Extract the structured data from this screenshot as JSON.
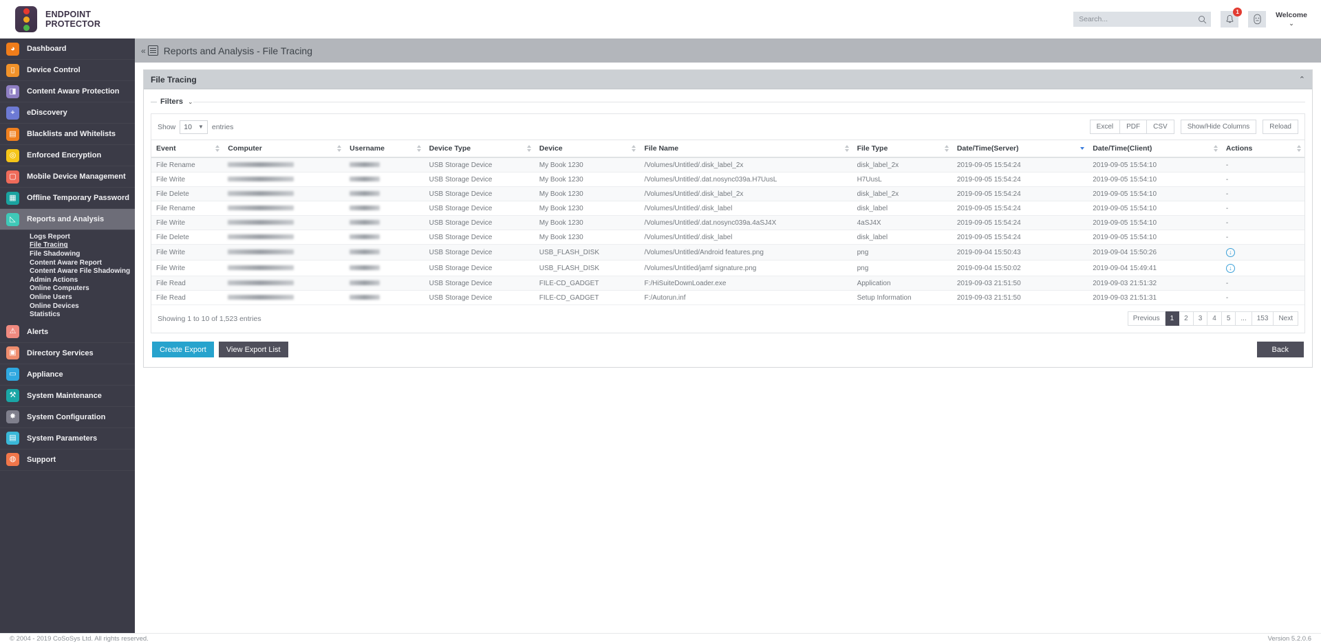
{
  "app": {
    "brand_line1": "ENDPOINT",
    "brand_line2": "PROTECTOR",
    "logo_icon": "traffic-light-icon"
  },
  "header": {
    "search_placeholder": "Search...",
    "search_value": "",
    "search_icon": "search-icon",
    "notifications_icon": "bell-icon",
    "notifications_count": "1",
    "profile_icon": "user-avatar-icon",
    "welcome_label": "Welcome",
    "welcome_caret": "⌄"
  },
  "sidebar": {
    "items": [
      {
        "label": "Dashboard",
        "icon": "dashboard-icon",
        "glyph": "◕",
        "color": "#f07d1a",
        "active": false
      },
      {
        "label": "Device Control",
        "icon": "usb-device-icon",
        "glyph": "▯",
        "color": "#f0922a",
        "active": false
      },
      {
        "label": "Content Aware Protection",
        "icon": "document-shield-icon",
        "glyph": "◨",
        "color": "#8f7fc4",
        "active": false
      },
      {
        "label": "eDiscovery",
        "icon": "telescope-icon",
        "glyph": "⌖",
        "color": "#6d7ad4",
        "active": false
      },
      {
        "label": "Blacklists and Whitelists",
        "icon": "list-icon",
        "glyph": "▤",
        "color": "#f0801f",
        "active": false
      },
      {
        "label": "Enforced Encryption",
        "icon": "disc-lock-icon",
        "glyph": "◎",
        "color": "#f5c518",
        "active": false
      },
      {
        "label": "Mobile Device Management",
        "icon": "mobile-icon",
        "glyph": "▢",
        "color": "#ef6b5a",
        "active": false
      },
      {
        "label": "Offline Temporary Password",
        "icon": "keypad-icon",
        "glyph": "▦",
        "color": "#1aa3a0",
        "active": false
      },
      {
        "label": "Reports and Analysis",
        "icon": "chart-report-icon",
        "glyph": "◺",
        "color": "#3fc9b8",
        "active": true
      },
      {
        "label": "Alerts",
        "icon": "warning-triangle-icon",
        "glyph": "⚠",
        "color": "#f08a80",
        "active": false
      },
      {
        "label": "Directory Services",
        "icon": "briefcase-icon",
        "glyph": "▣",
        "color": "#ef8d6e",
        "active": false
      },
      {
        "label": "Appliance",
        "icon": "server-icon",
        "glyph": "▭",
        "color": "#2fa8e0",
        "active": false
      },
      {
        "label": "System Maintenance",
        "icon": "tools-icon",
        "glyph": "⚒",
        "color": "#1aa6a6",
        "active": false
      },
      {
        "label": "System Configuration",
        "icon": "gear-icon",
        "glyph": "✸",
        "color": "#7f7f8c",
        "active": false
      },
      {
        "label": "System Parameters",
        "icon": "parameters-list-icon",
        "glyph": "▤",
        "color": "#3ab8d8",
        "active": false
      },
      {
        "label": "Support",
        "icon": "lifebuoy-icon",
        "glyph": "◍",
        "color": "#f0764a",
        "active": false
      }
    ],
    "submenu_parent_index": 8,
    "submenu": [
      {
        "label": "Logs Report",
        "active": false
      },
      {
        "label": "File Tracing",
        "active": true
      },
      {
        "label": "File Shadowing",
        "active": false
      },
      {
        "label": "Content Aware Report",
        "active": false
      },
      {
        "label": "Content Aware File Shadowing",
        "active": false
      },
      {
        "label": "Admin Actions",
        "active": false
      },
      {
        "label": "Online Computers",
        "active": false
      },
      {
        "label": "Online Users",
        "active": false
      },
      {
        "label": "Online Devices",
        "active": false
      },
      {
        "label": "Statistics",
        "active": false
      }
    ]
  },
  "breadcrumb": {
    "collapse_glyph": "«",
    "menu_icon": "hamburger-menu-icon",
    "text": "Reports and Analysis - File Tracing"
  },
  "panel": {
    "title": "File Tracing",
    "collapse_glyph": "⌃",
    "filters_label": "Filters",
    "filters_caret": "⌄"
  },
  "toolbar": {
    "show_label": "Show",
    "entries_value": "10",
    "entries_caret": "▼",
    "entries_label": "entries",
    "excel_label": "Excel",
    "pdf_label": "PDF",
    "csv_label": "CSV",
    "show_hide_columns_label": "Show/Hide Columns",
    "reload_label": "Reload"
  },
  "table": {
    "columns": [
      {
        "label": "Event",
        "sort": "none"
      },
      {
        "label": "Computer",
        "sort": "none"
      },
      {
        "label": "Username",
        "sort": "none"
      },
      {
        "label": "Device Type",
        "sort": "none"
      },
      {
        "label": "Device",
        "sort": "none"
      },
      {
        "label": "File Name",
        "sort": "none"
      },
      {
        "label": "File Type",
        "sort": "none"
      },
      {
        "label": "Date/Time(Server)",
        "sort": "desc"
      },
      {
        "label": "Date/Time(Client)",
        "sort": "none"
      },
      {
        "label": "Actions",
        "sort": "none"
      }
    ],
    "rows": [
      {
        "event": "File Rename",
        "computer": "",
        "username": "",
        "device_type": "USB Storage Device",
        "device": "My Book 1230",
        "file_name": "/Volumes/Untitled/.disk_label_2x",
        "file_type": "disk_label_2x",
        "dt_server": "2019-09-05 15:54:24",
        "dt_client": "2019-09-05 15:54:10",
        "action": "-"
      },
      {
        "event": "File Write",
        "computer": "",
        "username": "",
        "device_type": "USB Storage Device",
        "device": "My Book 1230",
        "file_name": "/Volumes/Untitled/.dat.nosync039a.H7UusL",
        "file_type": "H7UusL",
        "dt_server": "2019-09-05 15:54:24",
        "dt_client": "2019-09-05 15:54:10",
        "action": "-"
      },
      {
        "event": "File Delete",
        "computer": "",
        "username": "",
        "device_type": "USB Storage Device",
        "device": "My Book 1230",
        "file_name": "/Volumes/Untitled/.disk_label_2x",
        "file_type": "disk_label_2x",
        "dt_server": "2019-09-05 15:54:24",
        "dt_client": "2019-09-05 15:54:10",
        "action": "-"
      },
      {
        "event": "File Rename",
        "computer": "",
        "username": "",
        "device_type": "USB Storage Device",
        "device": "My Book 1230",
        "file_name": "/Volumes/Untitled/.disk_label",
        "file_type": "disk_label",
        "dt_server": "2019-09-05 15:54:24",
        "dt_client": "2019-09-05 15:54:10",
        "action": "-"
      },
      {
        "event": "File Write",
        "computer": "",
        "username": "",
        "device_type": "USB Storage Device",
        "device": "My Book 1230",
        "file_name": "/Volumes/Untitled/.dat.nosync039a.4aSJ4X",
        "file_type": "4aSJ4X",
        "dt_server": "2019-09-05 15:54:24",
        "dt_client": "2019-09-05 15:54:10",
        "action": "-"
      },
      {
        "event": "File Delete",
        "computer": "",
        "username": "",
        "device_type": "USB Storage Device",
        "device": "My Book 1230",
        "file_name": "/Volumes/Untitled/.disk_label",
        "file_type": "disk_label",
        "dt_server": "2019-09-05 15:54:24",
        "dt_client": "2019-09-05 15:54:10",
        "action": "-"
      },
      {
        "event": "File Write",
        "computer": "",
        "username": "",
        "device_type": "USB Storage Device",
        "device": "USB_FLASH_DISK",
        "file_name": "/Volumes/Untitled/Android features.png",
        "file_type": "png",
        "dt_server": "2019-09-04 15:50:43",
        "dt_client": "2019-09-04 15:50:26",
        "action": "download-icon"
      },
      {
        "event": "File Write",
        "computer": "",
        "username": "",
        "device_type": "USB Storage Device",
        "device": "USB_FLASH_DISK",
        "file_name": "/Volumes/Untitled/jamf signature.png",
        "file_type": "png",
        "dt_server": "2019-09-04 15:50:02",
        "dt_client": "2019-09-04 15:49:41",
        "action": "download-icon"
      },
      {
        "event": "File Read",
        "computer": "",
        "username": "",
        "device_type": "USB Storage Device",
        "device": "FILE-CD_GADGET",
        "file_name": "F:/HiSuiteDownLoader.exe",
        "file_type": "Application",
        "dt_server": "2019-09-03 21:51:50",
        "dt_client": "2019-09-03 21:51:32",
        "action": "-"
      },
      {
        "event": "File Read",
        "computer": "",
        "username": "",
        "device_type": "USB Storage Device",
        "device": "FILE-CD_GADGET",
        "file_name": "F:/Autorun.inf",
        "file_type": "Setup Information",
        "dt_server": "2019-09-03 21:51:50",
        "dt_client": "2019-09-03 21:51:31",
        "action": "-"
      }
    ],
    "showing_text": "Showing 1 to 10 of 1,523 entries",
    "pagination": [
      {
        "label": "Previous",
        "active": false
      },
      {
        "label": "1",
        "active": true
      },
      {
        "label": "2",
        "active": false
      },
      {
        "label": "3",
        "active": false
      },
      {
        "label": "4",
        "active": false
      },
      {
        "label": "5",
        "active": false
      },
      {
        "label": "...",
        "active": false
      },
      {
        "label": "153",
        "active": false
      },
      {
        "label": "Next",
        "active": false
      }
    ]
  },
  "actions": {
    "create_export_label": "Create Export",
    "view_export_list_label": "View Export List",
    "back_label": "Back"
  },
  "footer": {
    "copyright": "© 2004 - 2019 CoSoSys Ltd. All rights reserved.",
    "version": "Version 5.2.0.6"
  },
  "colors": {
    "accent_cyan": "#27a3cd",
    "sidebar_bg": "#3b3b47",
    "breadcrumb_bg": "#b3b6bb",
    "badge_red": "#e23b31",
    "sort_active_blue": "#3b7ddd"
  }
}
